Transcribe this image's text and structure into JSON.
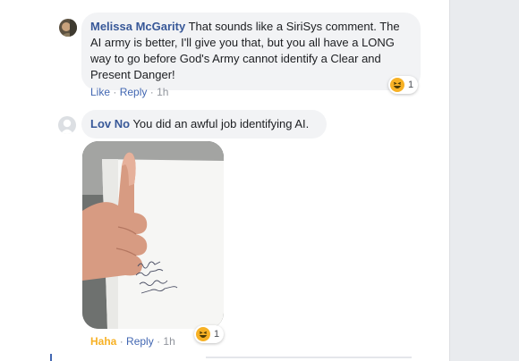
{
  "comments": [
    {
      "author": "Melissa McGarity",
      "text": "That sounds like a SiriSys comment. The AI army is better, I'll give you that, but you all have a LONG way to go before God's Army cannot identify a Clear and Present Danger!",
      "actions": {
        "like": "Like",
        "reply": "Reply",
        "time": "1h"
      },
      "reaction": {
        "icon": "haha-emoji-icon",
        "count": "1"
      }
    },
    {
      "author": "Lov No",
      "text": "You did an awful job identifying AI.",
      "actions": {
        "like": "Haha",
        "reply": "Reply",
        "time": "1h"
      },
      "reaction": {
        "icon": "haha-emoji-icon",
        "count": "1"
      }
    }
  ],
  "separator": "·",
  "colors": {
    "author": "#385898",
    "link": "#4267b2",
    "meta": "#90949c",
    "bubble": "#f2f3f5",
    "haha": "#f7b125",
    "gutter": "#e9ebee"
  }
}
